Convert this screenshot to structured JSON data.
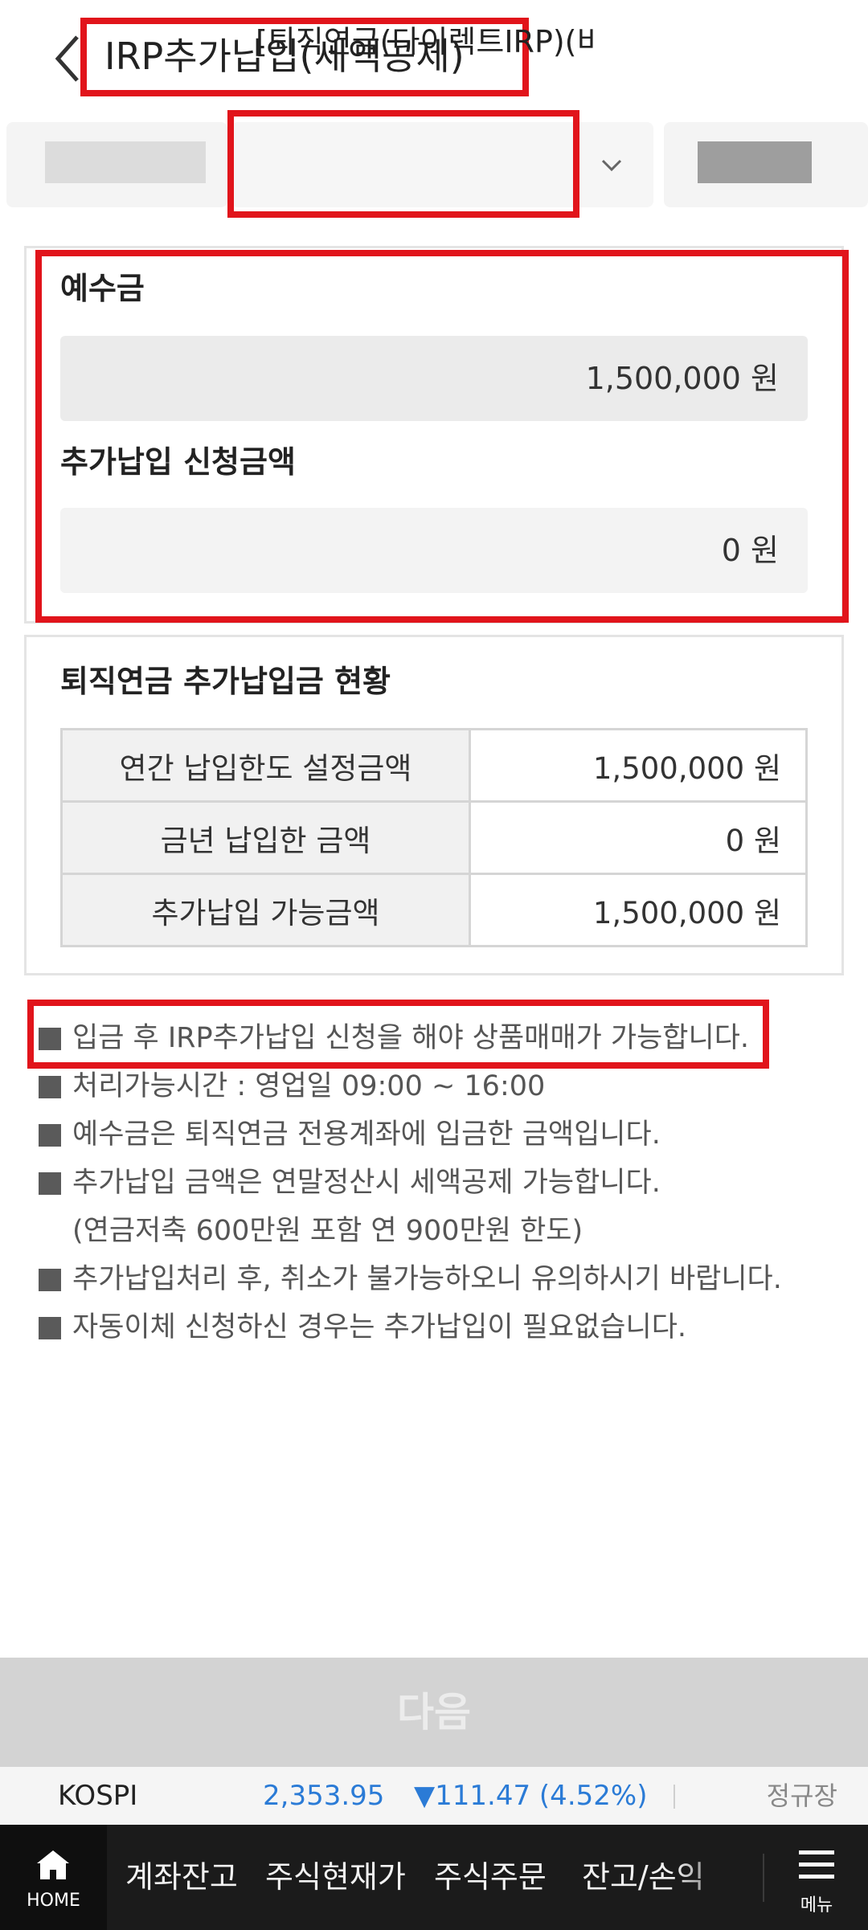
{
  "header": {
    "title": "IRP추가납입(세액공제)"
  },
  "account_selector": {
    "selected_label": "[퇴직연금(다이렉트IRP)(비대"
  },
  "balance_panel": {
    "deposit_title": "예수금",
    "deposit_amount": "1,500,000 원",
    "request_title": "추가납입 신청금액",
    "request_amount": "0 원"
  },
  "status_panel": {
    "title": "퇴직연금 추가납입금 현황",
    "rows": [
      {
        "label": "연간 납입한도 설정금액",
        "value": "1,500,000 원"
      },
      {
        "label": "금년 납입한 금액",
        "value": "0 원"
      },
      {
        "label": "추가납입 가능금액",
        "value": "1,500,000 원"
      }
    ]
  },
  "notes": [
    "입금 후 IRP추가납입 신청을 해야 상품매매가 가능합니다.",
    "처리가능시간 : 영업일 09:00 ~ 16:00",
    "예수금은 퇴직연금 전용계좌에 입금한 금액입니다.",
    "추가납입 금액은 연말정산시 세액공제 가능합니다.",
    "(연금저축 600만원 포함 연 900만원 한도)",
    "추가납입처리 후, 취소가 불가능하오니 유의하시기 바랍니다.",
    "자동이체 신청하신 경우는 추가납입이 필요없습니다."
  ],
  "next_button": {
    "label": "다음"
  },
  "ticker": {
    "name": "KOSPI",
    "price": "2,353.95",
    "change": "▼111.47 (4.52%)",
    "session": "정규장"
  },
  "bottom_nav": {
    "home_label": "HOME",
    "items": [
      "계좌잔고",
      "주식현재가",
      "주식주문",
      "잔고/손익"
    ],
    "menu_label": "메뉴"
  },
  "colors": {
    "highlight_border": "#e1141b",
    "ticker_blue": "#2b7bd6",
    "nav_background": "#1b1b1b",
    "next_button_disabled": "#d3d3d3"
  }
}
